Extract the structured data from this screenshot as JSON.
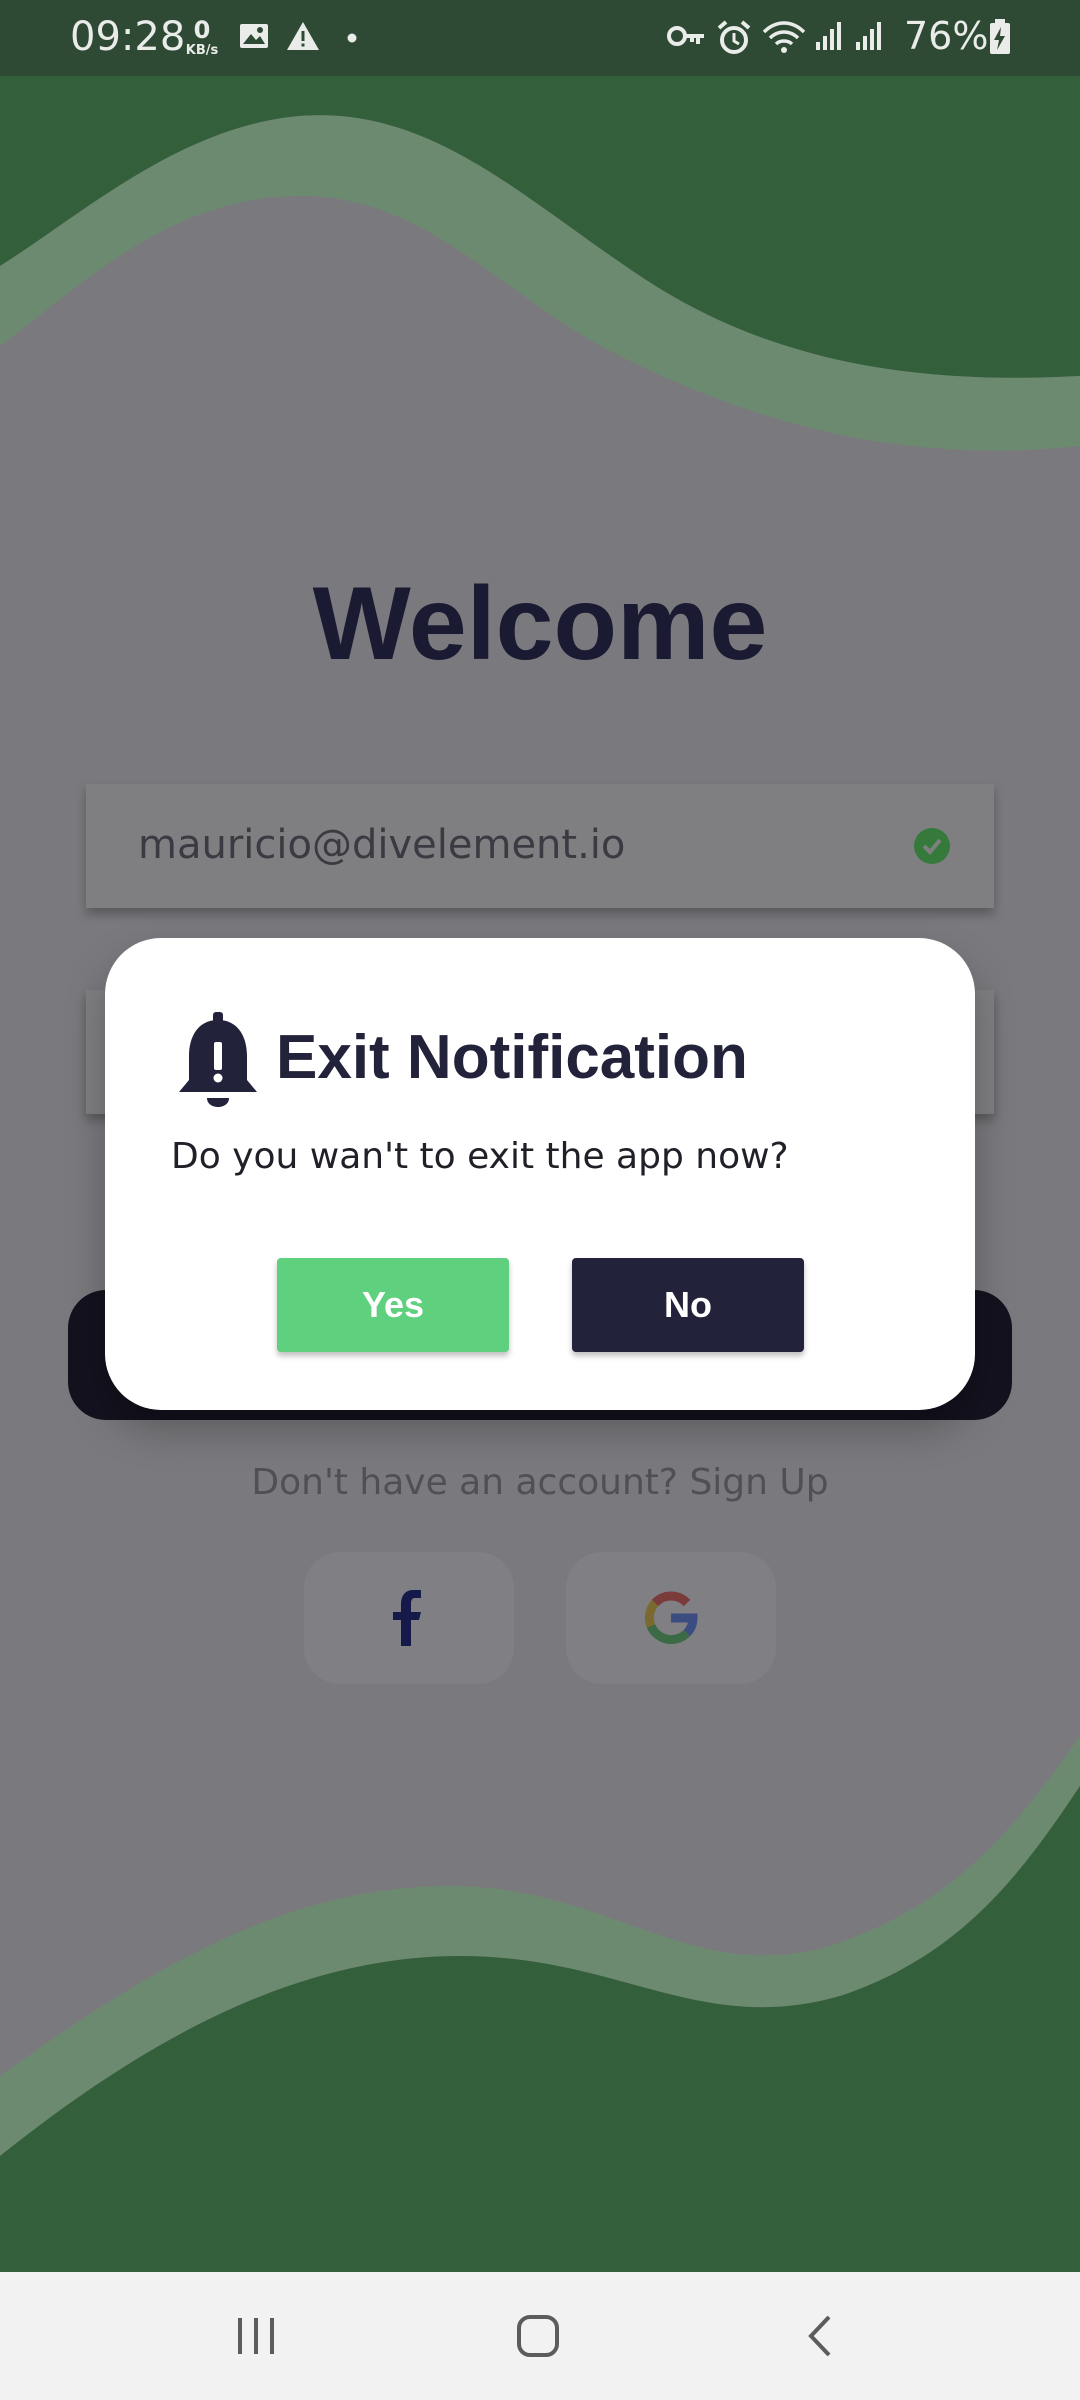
{
  "status_bar": {
    "time": "09:28",
    "net_speed_value": "0",
    "net_speed_unit": "KB/s",
    "battery": "76%",
    "icons": [
      "image-icon",
      "warning-icon",
      "dot-icon",
      "vpn-key-icon",
      "alarm-icon",
      "wifi-icon",
      "signal-icon",
      "signal-icon",
      "battery-charging-icon"
    ]
  },
  "login": {
    "welcome": "Welcome",
    "email_value": "mauricio@divelement.io",
    "signup_text": "Don't have an account? Sign Up",
    "social": [
      "facebook-icon",
      "google-icon"
    ]
  },
  "dialog": {
    "title": "Exit Notification",
    "message": "Do you wan't to exit the app now?",
    "yes_label": "Yes",
    "no_label": "No",
    "icon": "bell-alert-icon"
  },
  "nav": [
    "recents-button",
    "home-button",
    "back-button"
  ],
  "colors": {
    "green": "#2f5f38",
    "accent_green": "#5fd07e",
    "navy": "#22223a",
    "scrim": "#7a7a7e"
  }
}
